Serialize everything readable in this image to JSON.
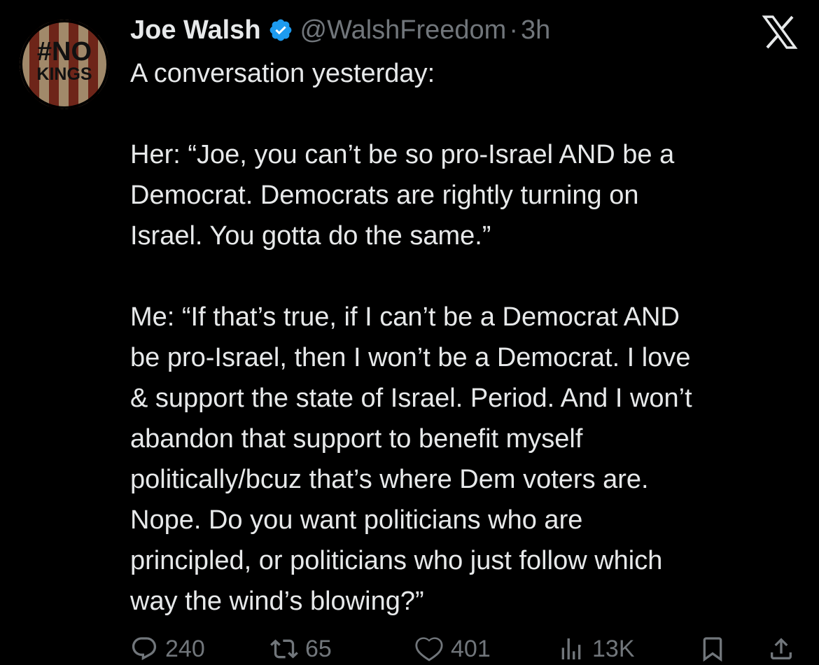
{
  "tweet": {
    "display_name": "Joe Walsh",
    "handle": "@WalshFreedom",
    "separator": "·",
    "time": "3h",
    "verified_icon": "verified-badge-icon",
    "avatar": {
      "line1": "#NO",
      "line2": "KINGS"
    },
    "paragraphs": [
      {
        "lines": [
          "A conversation yesterday:"
        ]
      },
      {
        "lines": [
          "Her: “Joe, you can’t be so pro-Israel AND be a",
          "Democrat. Democrats are rightly turning on",
          "Israel. You gotta do the same.”"
        ]
      },
      {
        "lines": [
          "Me: “If that’s true, if I can’t be a Democrat AND",
          "be pro-Israel, then I won’t be a Democrat. I love",
          "& support the state of Israel. Period. And I won’t",
          "abandon that support to benefit myself",
          "politically/bcuz that’s where Dem voters are.",
          "Nope. Do you want politicians who are",
          "principled, or politicians who just follow which",
          "way the wind’s blowing?”"
        ]
      }
    ]
  },
  "actions": {
    "replies": "240",
    "reposts": "65",
    "likes": "401",
    "views": "13K"
  },
  "colors": {
    "background": "#000000",
    "text": "#e7e9ea",
    "muted": "#71767b",
    "verified": "#1d9bf0"
  }
}
